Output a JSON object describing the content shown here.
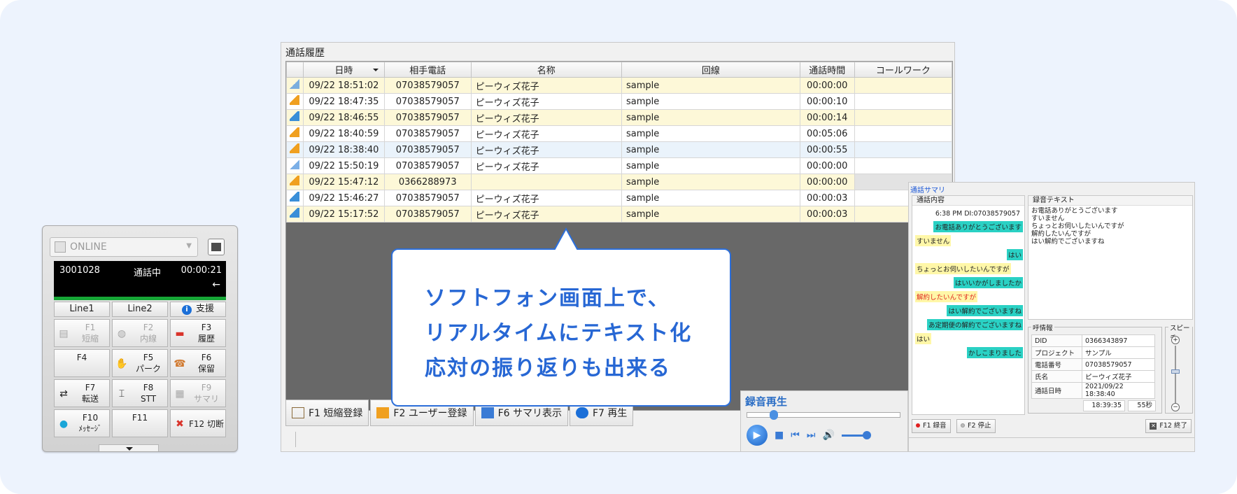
{
  "softphone": {
    "status": "ONLINE",
    "extension": "3001028",
    "call_state": "通話中",
    "duration": "00:00:21",
    "direction_arrow": "←",
    "line1": "Line1",
    "line2": "Line2",
    "support": "支援",
    "keys": [
      {
        "fkey": "F1",
        "label": "短縮",
        "enabled": false,
        "icon": "phonebook-icon"
      },
      {
        "fkey": "F2",
        "label": "内線",
        "enabled": false,
        "icon": "globe-icon"
      },
      {
        "fkey": "F3",
        "label": "履歴",
        "enabled": true,
        "icon": "history-icon"
      },
      {
        "fkey": "F4",
        "label": "",
        "enabled": true,
        "icon": ""
      },
      {
        "fkey": "F5",
        "label": "パーク",
        "enabled": true,
        "icon": "park-icon"
      },
      {
        "fkey": "F6",
        "label": "保留",
        "enabled": true,
        "icon": "hold-icon"
      },
      {
        "fkey": "F7",
        "label": "転送",
        "enabled": true,
        "icon": "transfer-icon"
      },
      {
        "fkey": "F8",
        "label": "STT",
        "enabled": true,
        "icon": "stt-icon"
      },
      {
        "fkey": "F9",
        "label": "サマリ",
        "enabled": false,
        "icon": "summary-icon"
      },
      {
        "fkey": "F10",
        "label": "ﾒｯｾｰｼﾞ",
        "enabled": true,
        "icon": "message-icon"
      },
      {
        "fkey": "F11",
        "label": "",
        "enabled": true,
        "icon": ""
      },
      {
        "fkey": "F12",
        "label": "切断",
        "enabled": true,
        "icon": "hangup-icon"
      }
    ]
  },
  "history": {
    "title": "通話履歴",
    "columns": [
      "日時",
      "相手電話",
      "名称",
      "回線",
      "通話時間",
      "コールワーク"
    ],
    "rows": [
      {
        "dir": "miss",
        "datetime": "09/22 18:51:02",
        "phone": "07038579057",
        "name": "ピーウィズ花子",
        "line": "sample",
        "duration": "00:00:00",
        "work": ""
      },
      {
        "dir": "out",
        "datetime": "09/22 18:47:35",
        "phone": "07038579057",
        "name": "ピーウィズ花子",
        "line": "sample",
        "duration": "00:00:10",
        "work": ""
      },
      {
        "dir": "in",
        "datetime": "09/22 18:46:55",
        "phone": "07038579057",
        "name": "ピーウィズ花子",
        "line": "sample",
        "duration": "00:00:14",
        "work": ""
      },
      {
        "dir": "out",
        "datetime": "09/22 18:40:59",
        "phone": "07038579057",
        "name": "ピーウィズ花子",
        "line": "sample",
        "duration": "00:05:06",
        "work": ""
      },
      {
        "dir": "out",
        "datetime": "09/22 18:38:40",
        "phone": "07038579057",
        "name": "ピーウィズ花子",
        "line": "sample",
        "duration": "00:00:55",
        "work": ""
      },
      {
        "dir": "miss",
        "datetime": "09/22 15:50:19",
        "phone": "07038579057",
        "name": "ピーウィズ花子",
        "line": "sample",
        "duration": "00:00:00",
        "work": ""
      },
      {
        "dir": "out",
        "datetime": "09/22 15:47:12",
        "phone": "0366288973",
        "name": "",
        "line": "sample",
        "duration": "00:00:00",
        "work": ""
      },
      {
        "dir": "in",
        "datetime": "09/22 15:46:27",
        "phone": "07038579057",
        "name": "ピーウィズ花子",
        "line": "sample",
        "duration": "00:00:03",
        "work": ""
      },
      {
        "dir": "in",
        "datetime": "09/22 15:17:52",
        "phone": "07038579057",
        "name": "ピーウィズ花子",
        "line": "sample",
        "duration": "00:00:03",
        "work": ""
      }
    ],
    "fkeys": [
      {
        "label": "F1 短縮登録",
        "icon": "book-icon"
      },
      {
        "label": "F2 ユーザー登録",
        "icon": "user-card-icon"
      },
      {
        "label": "F6 サマリ表示",
        "icon": "summary-view-icon"
      },
      {
        "label": "F7 再生",
        "icon": "play-icon"
      }
    ]
  },
  "player": {
    "title": "録音再生"
  },
  "summary": {
    "title": "通話サマリ",
    "conversation_header": "通話内容",
    "meta": "6:38 PM DI:07038579057",
    "messages": [
      {
        "side": "right",
        "text": "お電話ありがとうございます"
      },
      {
        "side": "left",
        "text": "すいません"
      },
      {
        "side": "right",
        "text": "はい"
      },
      {
        "side": "left",
        "text": "ちょっとお伺いしたいんですが"
      },
      {
        "side": "right",
        "text": "はいいかがしましたか"
      },
      {
        "side": "left-red",
        "text": "解約したいんですが"
      },
      {
        "side": "right",
        "text": "はい解約でございますね"
      },
      {
        "side": "right",
        "text": "あ定期便の解約でございますね"
      },
      {
        "side": "left",
        "text": "はい"
      },
      {
        "side": "right",
        "text": "かしこまりました"
      }
    ],
    "transcript_header": "録音テキスト",
    "transcript": "お電話ありがとうございます\nすいません\nちょっとお伺いしたいんですが\n解約したいんですが\nはい解約でございますね",
    "info_legend": "呼情報",
    "info": [
      {
        "key": "DID",
        "value": "0366343897"
      },
      {
        "key": "プロジェクト",
        "value": "サンプル"
      },
      {
        "key": "電話番号",
        "value": "07038579057"
      },
      {
        "key": "氏名",
        "value": "ピーウィズ花子"
      },
      {
        "key": "通話日時",
        "value": "2021/09/22 18:38:40"
      }
    ],
    "end_time": "18:39:35",
    "elapsed": "55秒",
    "speed_legend": "スピーチ",
    "btn_record": "F1 録音",
    "btn_stop": "F2 停止",
    "btn_close": "F12 終了"
  },
  "callout": {
    "lines": [
      "ソフトフォン画面上で、",
      "リアルタイムにテキスト化",
      "応対の振り返りも出来る"
    ]
  }
}
